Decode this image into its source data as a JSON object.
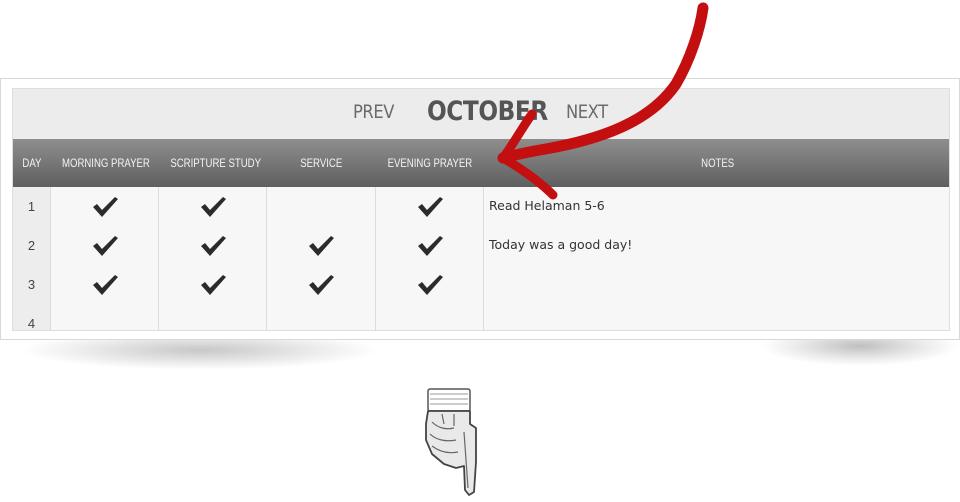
{
  "calendar": {
    "prev_label": "PREV",
    "month": "OCTOBER",
    "next_label": "NEXT",
    "columns": [
      "DAY",
      "MORNING PRAYER",
      "SCRIPTURE STUDY",
      "SERVICE",
      "EVENING PRAYER",
      "NOTES"
    ],
    "rows": [
      {
        "day": "1",
        "morning_prayer": true,
        "scripture_study": true,
        "service": false,
        "evening_prayer": true,
        "notes": "Read Helaman 5-6"
      },
      {
        "day": "2",
        "morning_prayer": true,
        "scripture_study": true,
        "service": true,
        "evening_prayer": true,
        "notes": "Today was a good day!"
      },
      {
        "day": "3",
        "morning_prayer": true,
        "scripture_study": true,
        "service": true,
        "evening_prayer": true,
        "notes": ""
      },
      {
        "day": "4",
        "morning_prayer": false,
        "scripture_study": false,
        "service": false,
        "evening_prayer": false,
        "notes": ""
      }
    ]
  },
  "annotation": {
    "arrow_color": "#c40f10",
    "icon": "pointing-hand-icon"
  },
  "colors": {
    "header_dark": "#5f5f5f",
    "header_light": "#8e8e8e",
    "check": "#2b2b2b"
  }
}
